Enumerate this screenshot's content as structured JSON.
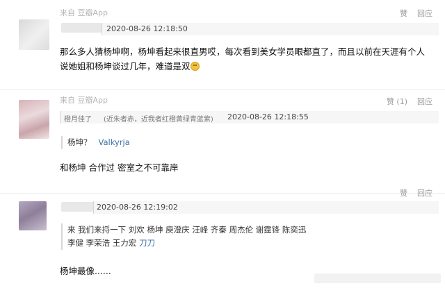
{
  "comments": [
    {
      "source": "来自 豆瓣App",
      "actions": {
        "like": "赞",
        "reply": "回应"
      },
      "timestamp": "2020-08-26 12:18:50",
      "text": "那么多人猜杨坤啊，杨坤看起来很直男哎，每次看到美女学员眼都直了，而且以前在天涯有个人说她姐和杨坤谈过几年，难道是双"
    },
    {
      "source": "来自 豆瓣App",
      "actions": {
        "like": "赞 (1)",
        "reply": "回应"
      },
      "username": "橙月佳了",
      "signature": "(近朱者赤，近我者红橙黄绿青蓝紫)",
      "timestamp": "2020-08-26 12:18:55",
      "quote": {
        "text": "杨坤？",
        "user": "Valkyrja"
      },
      "text": "和杨坤 合作过 密室之不可靠岸"
    },
    {
      "actions": {
        "like": "赞",
        "reply": "回应"
      },
      "timestamp": "2020-08-26 12:19:02",
      "quote": {
        "line1": "来 我们来捋一下 刘欢 杨坤 庾澄庆 汪峰 齐秦 周杰伦 谢霆锋 陈奕迅",
        "line2": "李健 李荣浩 王力宏",
        "sticker": "刀刀"
      },
      "text": "杨坤最像......"
    }
  ]
}
